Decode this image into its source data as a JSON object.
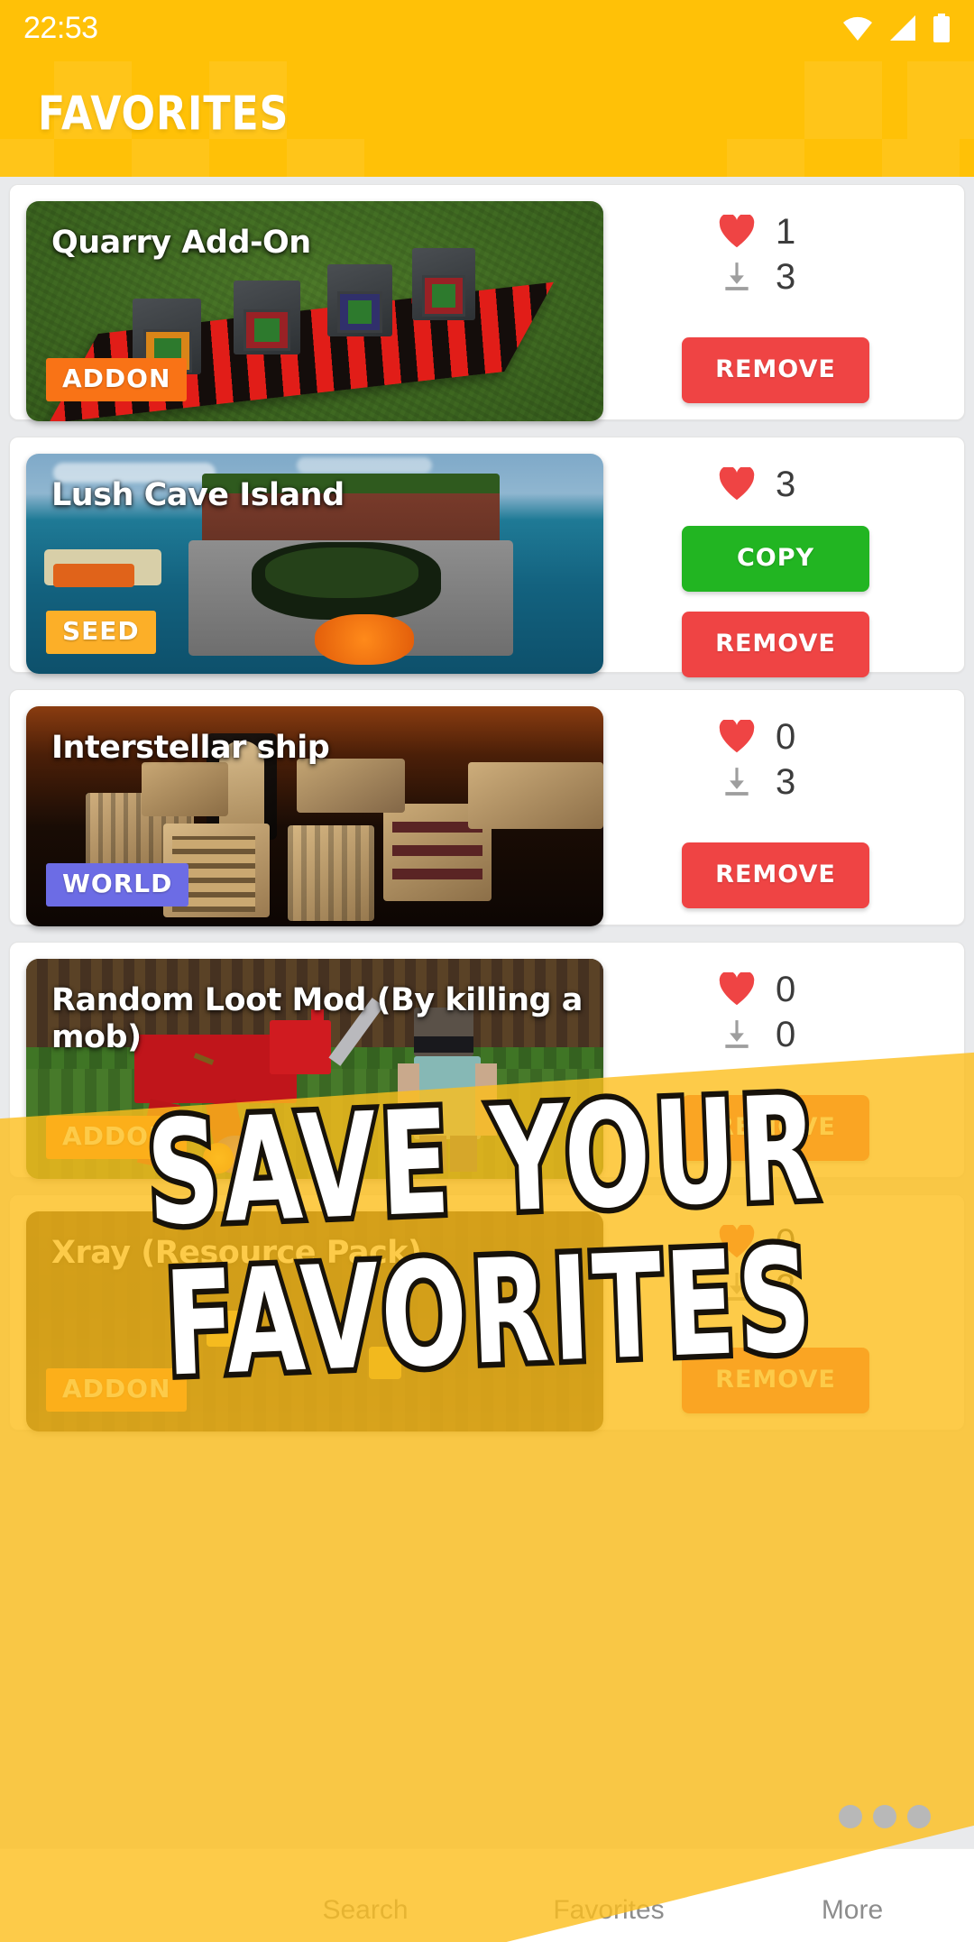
{
  "status_bar": {
    "time": "22:53",
    "icons": [
      "wifi-icon",
      "signal-icon",
      "battery-icon"
    ]
  },
  "header": {
    "title": "FAVORITES",
    "background_color": "#FFC107"
  },
  "colors": {
    "accent": "#FFC107",
    "remove_button": "#EF4444",
    "copy_button": "#22B522",
    "heart": "#EF4444",
    "badge_addon": "#F97316",
    "badge_seed": "#FCAF28",
    "badge_world": "#6C6CE5"
  },
  "cards": [
    {
      "title": "Quarry Add-On",
      "badge": "ADDON",
      "badge_type": "addon",
      "likes": "1",
      "downloads": "3",
      "has_downloads": true,
      "buttons": [
        {
          "label": "REMOVE",
          "kind": "remove"
        }
      ]
    },
    {
      "title": "Lush Cave Island",
      "badge": "SEED",
      "badge_type": "seed",
      "likes": "3",
      "downloads": "",
      "has_downloads": false,
      "buttons": [
        {
          "label": "COPY",
          "kind": "copy"
        },
        {
          "label": "REMOVE",
          "kind": "remove"
        }
      ]
    },
    {
      "title": "Interstellar ship",
      "badge": "WORLD",
      "badge_type": "world",
      "likes": "0",
      "downloads": "3",
      "has_downloads": true,
      "buttons": [
        {
          "label": "REMOVE",
          "kind": "remove"
        }
      ]
    },
    {
      "title": "Random Loot Mod (By killing a mob)",
      "badge": "ADDON",
      "badge_type": "addon",
      "likes": "0",
      "downloads": "0",
      "has_downloads": true,
      "buttons": [
        {
          "label": "REMOVE",
          "kind": "remove"
        }
      ]
    },
    {
      "title": "Xray (Resource Pack)",
      "badge": "ADDON",
      "badge_type": "addon",
      "likes": "0",
      "downloads": "2",
      "has_downloads": true,
      "buttons": [
        {
          "label": "REMOVE",
          "kind": "remove"
        }
      ]
    }
  ],
  "promo_overlay": {
    "line1": "SAVE YOUR",
    "line2": "FAVORITES",
    "tint_color": "#FDBE1C"
  },
  "bottom_nav": {
    "items": [
      {
        "label": "",
        "name": "nav-item-mods"
      },
      {
        "label": "Search",
        "name": "nav-item-search"
      },
      {
        "label": "Favorites",
        "name": "nav-item-favorites"
      },
      {
        "label": "More",
        "name": "nav-item-more"
      }
    ]
  }
}
